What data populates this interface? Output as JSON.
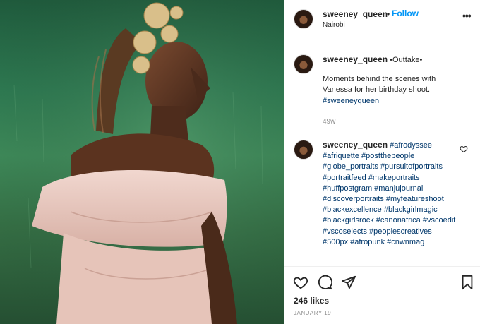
{
  "post": {
    "username": "sweeney_queen",
    "separator": "•",
    "follow_label": "Follow",
    "location": "Nairobi",
    "more_label": "•••"
  },
  "caption": {
    "username": "sweeney_queen",
    "headline": "•Outtake•",
    "text": "Moments behind the scenes with Vanessa for her birthday shoot.",
    "hashtag": "#sweeneyqueen",
    "age": "49w"
  },
  "comment": {
    "username": "sweeney_queen",
    "hashtags_line1": "#afrodyssee",
    "hashtags": "#afriquette #postthepeople #globe_portraits #pursuitofportraits #portraitfeed #makeportraits #huffpostgram #manjujournal #discoverportraits #myfeatureshoot #blackexcellence #blackgirlmagic #blackgirlsrock #canonafrica #vscoedit #vscoselects #peoplescreatives #500px #afropunk #cnwnmag"
  },
  "footer": {
    "likes": "246 likes",
    "date": "JANUARY 19"
  },
  "icons": {
    "like": "heart-icon",
    "comment": "comment-icon",
    "share": "paper-plane-icon",
    "save": "bookmark-icon"
  },
  "colors": {
    "link": "#0095f6",
    "hashtag": "#00376b",
    "muted": "#8e8e8e",
    "text": "#262626"
  }
}
